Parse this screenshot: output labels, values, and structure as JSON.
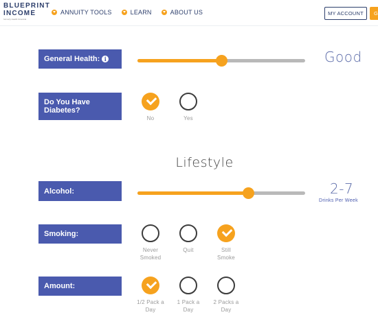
{
  "header": {
    "logo_line1": "BLUEPRINT",
    "logo_line2": "INCOME",
    "logo_sub": "formerly Health Financial",
    "nav": [
      {
        "label": "ANNUITY TOOLS",
        "icon": "chevron-down-icon"
      },
      {
        "label": "LEARN",
        "icon": "chevron-down-icon"
      },
      {
        "label": "ABOUT US",
        "icon": "chevron-down-icon"
      }
    ],
    "my_account": "MY ACCOUNT",
    "cta_label": "G"
  },
  "health": {
    "general_health": {
      "label": "General Health:",
      "info_icon": "info-icon",
      "slider_fraction": 0.5,
      "value": "Good"
    },
    "diabetes": {
      "label": "Do You Have Diabetes?",
      "options": [
        {
          "label": "No",
          "checked": true
        },
        {
          "label": "Yes",
          "checked": false
        }
      ]
    }
  },
  "lifestyle": {
    "title": "Lifestyle",
    "alcohol": {
      "label": "Alcohol:",
      "slider_fraction": 0.66,
      "value": "2-7",
      "unit": "Drinks Per Week"
    },
    "smoking": {
      "label": "Smoking:",
      "options": [
        {
          "label": "Never Smoked",
          "checked": false
        },
        {
          "label": "Quit",
          "checked": false
        },
        {
          "label": "Still Smoke",
          "checked": true
        }
      ]
    },
    "amount": {
      "label": "Amount:",
      "options": [
        {
          "label": "1/2 Pack a Day",
          "checked": true
        },
        {
          "label": "1 Pack a Day",
          "checked": false
        },
        {
          "label": "2 Packs a Day",
          "checked": false
        }
      ]
    }
  },
  "colors": {
    "accent": "#f6a21e",
    "label_bg": "#4a5aae",
    "brand": "#2c3e6b"
  }
}
